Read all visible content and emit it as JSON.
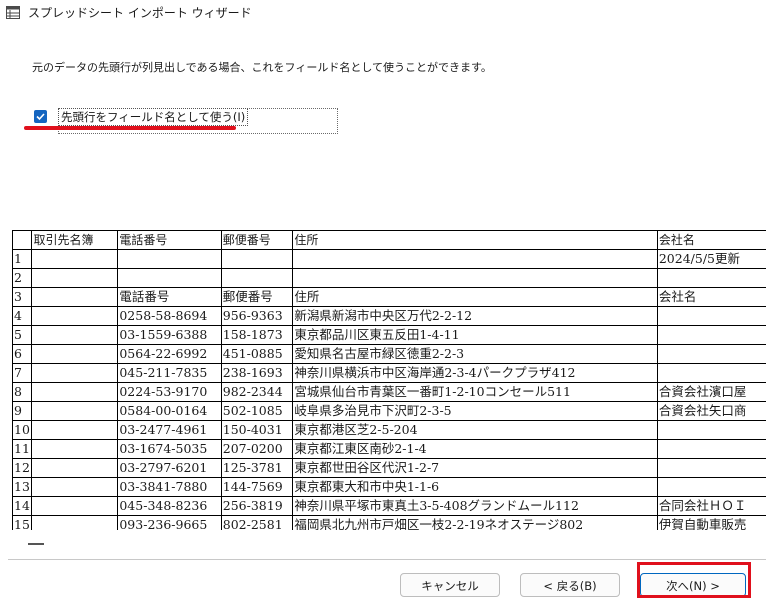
{
  "window": {
    "title": "スプレッドシート インポート ウィザード"
  },
  "instruction": "元のデータの先頭行が列見出しである場合、これをフィールド名として使うことができます。",
  "checkbox": {
    "label": "先頭行をフィールド名として使う(I)",
    "checked": true
  },
  "grid": {
    "columns": [
      "",
      "取引先名簿",
      "電話番号",
      "郵便番号",
      "住所",
      "会社名"
    ],
    "rows": [
      [
        "1",
        "",
        "",
        "",
        "",
        "2024/5/5更新"
      ],
      [
        "2",
        "",
        "",
        "",
        "",
        ""
      ],
      [
        "3",
        "",
        "電話番号",
        "郵便番号",
        "住所",
        "会社名"
      ],
      [
        "4",
        "",
        "0258-58-8694",
        "956-9363",
        "新潟県新潟市中央区万代2-2-12",
        ""
      ],
      [
        "5",
        "",
        "03-1559-6388",
        "158-1873",
        "東京都品川区東五反田1-4-11",
        ""
      ],
      [
        "6",
        "",
        "0564-22-6992",
        "451-0885",
        "愛知県名古屋市緑区徳重2-2-3",
        ""
      ],
      [
        "7",
        "",
        "045-211-7835",
        "238-1693",
        "神奈川県横浜市中区海岸通2-3-4パークプラザ412",
        ""
      ],
      [
        "8",
        "",
        "0224-53-9170",
        "982-2344",
        "宮城県仙台市青葉区一番町1-2-10コンセール511",
        "合資会社濱口屋"
      ],
      [
        "9",
        "",
        "0584-00-0164",
        "502-1085",
        "岐阜県多治見市下沢町2-3-5",
        "合資会社矢口商"
      ],
      [
        "10",
        "",
        "03-2477-4961",
        "150-4031",
        "東京都港区芝2-5-204",
        ""
      ],
      [
        "11",
        "",
        "03-1674-5035",
        "207-0200",
        "東京都江東区南砂2-1-4",
        ""
      ],
      [
        "12",
        "",
        "03-2797-6201",
        "125-3781",
        "東京都世田谷区代沢1-2-7",
        ""
      ],
      [
        "13",
        "",
        "03-3841-7880",
        "144-7569",
        "東京都東大和市中央1-1-6",
        ""
      ],
      [
        "14",
        "",
        "045-348-8236",
        "256-3819",
        "神奈川県平塚市東真土3-5-408グランドムール112",
        "合同会社ＨＯＩ"
      ],
      [
        "15",
        "",
        "093-236-9665",
        "802-2581",
        "福岡県北九州市戸畑区一枝2-2-19ネオステージ802",
        "伊賀自動車販売"
      ]
    ]
  },
  "buttons": {
    "cancel": "キャンセル",
    "back": "< 戻る(B)",
    "next": "次へ(N) >"
  },
  "colors": {
    "accent": "#0067c0",
    "checkbox": "#1465c0",
    "highlight_red": "#e0101c"
  },
  "icons": {
    "app": "table-window-icon"
  }
}
